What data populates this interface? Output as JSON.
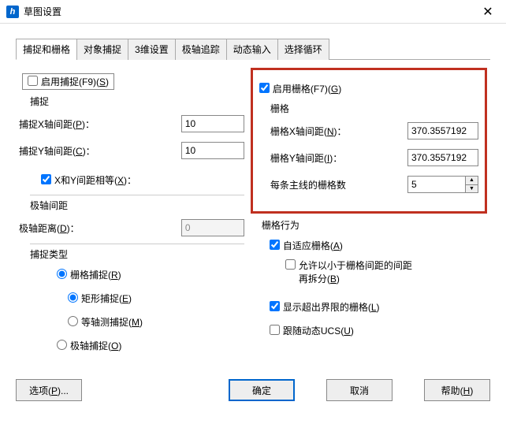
{
  "window": {
    "title": "草图设置",
    "icon_text": "h"
  },
  "tabs": [
    "捕捉和栅格",
    "对象捕捉",
    "3维设置",
    "极轴追踪",
    "动态输入",
    "选择循环"
  ],
  "active_tab": 0,
  "left": {
    "enable_snap": "启用捕捉(F9)(S)",
    "snap_group": "捕捉",
    "snap_x_label": "捕捉X轴间距(P)：",
    "snap_x_value": "10",
    "snap_y_label": "捕捉Y轴间距(C)：",
    "snap_y_value": "10",
    "equal_xy": "X和Y间距相等(X)：",
    "polar_group": "极轴间距",
    "polar_dist_label": "极轴距离(D)：",
    "polar_dist_value": "0",
    "snap_type_group": "捕捉类型",
    "grid_snap": "栅格捕捉(R)",
    "rect_snap": "矩形捕捉(E)",
    "iso_snap": "等轴测捕捉(M)",
    "polar_snap": "极轴捕捉(O)"
  },
  "right": {
    "enable_grid": "启用栅格(F7)(G)",
    "grid_group": "栅格",
    "grid_x_label": "栅格X轴间距(N)：",
    "grid_x_value": "370.3557192",
    "grid_y_label": "栅格Y轴间距(I)：",
    "grid_y_value": "370.3557192",
    "major_lines_label": "每条主线的栅格数",
    "major_lines_value": "5",
    "behavior_group": "栅格行为",
    "adaptive": "自适应栅格(A)",
    "subdiv1": "允许以小于栅格间距的间距",
    "subdiv2": "再拆分(B)",
    "show_beyond": "显示超出界限的栅格(L)",
    "follow_ucs": "跟随动态UCS(U)"
  },
  "footer": {
    "options": "选项(P)...",
    "ok": "确定",
    "cancel": "取消",
    "help": "帮助(H)"
  }
}
